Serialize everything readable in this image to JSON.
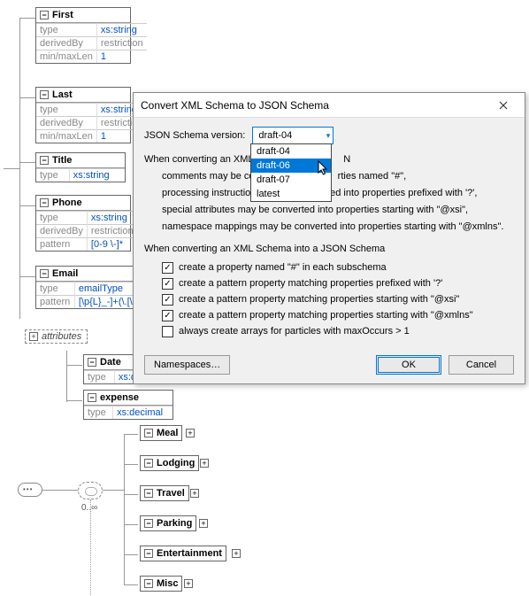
{
  "background": {
    "boxes": {
      "first": {
        "label": "First",
        "rows": [
          {
            "k": "type",
            "v": "xs:string",
            "blue": true
          },
          {
            "k": "derivedBy",
            "v": "restriction",
            "blue": false
          },
          {
            "k": "min/maxLen",
            "v": "1",
            "blue": true
          }
        ]
      },
      "last": {
        "label": "Last",
        "rows": [
          {
            "k": "type",
            "v": "xs:string",
            "blue": true
          },
          {
            "k": "derivedBy",
            "v": "restrictio",
            "blue": false
          },
          {
            "k": "min/maxLen",
            "v": "1",
            "blue": true
          }
        ]
      },
      "title": {
        "label": "Title",
        "rows": [
          {
            "k": "type",
            "v": "xs:string",
            "blue": true
          }
        ]
      },
      "phone": {
        "label": "Phone",
        "rows": [
          {
            "k": "type",
            "v": "xs:string",
            "blue": true
          },
          {
            "k": "derivedBy",
            "v": "restriction",
            "blue": false
          },
          {
            "k": "pattern",
            "v": "[0-9 \\-]*",
            "blue": true
          }
        ]
      },
      "email": {
        "label": "Email",
        "rows": [
          {
            "k": "type",
            "v": "emailType",
            "blue": true
          },
          {
            "k": "pattern",
            "v": "[\\p{L}_-]+(\\.[\\p",
            "blue": true
          }
        ]
      },
      "date": {
        "label": "Date",
        "rows": [
          {
            "k": "type",
            "v": "xs:date",
            "blue": true
          }
        ]
      },
      "expense": {
        "label": "expense",
        "rows": [
          {
            "k": "type",
            "v": "xs:decimal",
            "blue": true
          }
        ]
      }
    },
    "attributes_label": "attributes",
    "simple": {
      "meal": "Meal",
      "lodging": "Lodging",
      "travel": "Travel",
      "parking": "Parking",
      "entertainment": "Entertainment",
      "misc": "Misc"
    },
    "cardinality": "0..∞"
  },
  "dialog": {
    "title": "Convert XML Schema to JSON Schema",
    "version_label": "JSON Schema version:",
    "combo_value": "draft-04",
    "options": [
      "draft-04",
      "draft-06",
      "draft-07",
      "latest"
    ],
    "highlighted": "draft-06",
    "para1_head": "When converting an XML",
    "para1_tail_pre": "N",
    "para1_l1_a": "comments may be co",
    "para1_l1_b": "rties named \"#\",",
    "para1_l2": "processing instructions may be converted into properties prefixed with '?',",
    "para1_l3": "special attributes may be converted into properties starting with \"@xsi\",",
    "para1_l4": "namespace mappings may be converted into properties starting with \"@xmlns\".",
    "para2_head": "When converting an XML Schema into a JSON Schema",
    "checkboxes": [
      {
        "checked": true,
        "label": "create a property named \"#\" in each subschema"
      },
      {
        "checked": true,
        "label": "create a pattern property matching properties prefixed with '?'"
      },
      {
        "checked": true,
        "label": "create a pattern property matching properties starting with \"@xsi\""
      },
      {
        "checked": true,
        "label": "create a pattern property matching properties starting with \"@xmlns\""
      },
      {
        "checked": false,
        "label": "always create arrays for particles with maxOccurs > 1"
      }
    ],
    "namespaces_btn": "Namespaces…",
    "ok_btn": "OK",
    "cancel_btn": "Cancel"
  }
}
